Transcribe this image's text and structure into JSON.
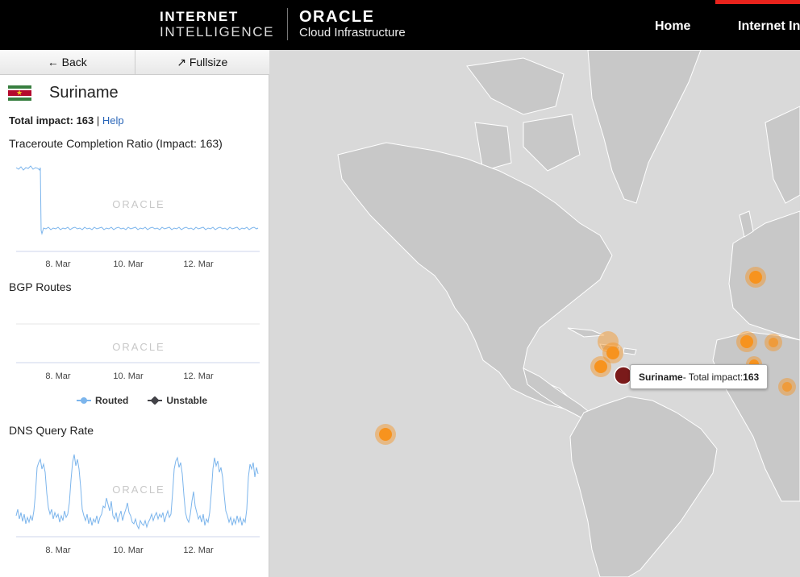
{
  "header": {
    "brand_line1": "INTERNET",
    "brand_line2": "INTELLIGENCE",
    "oracle_line1": "ORACLE",
    "oracle_line2": "Cloud Infrastructure",
    "nav": [
      {
        "label": "Home"
      },
      {
        "label": "Internet In"
      }
    ],
    "accent_color": "#e8231c"
  },
  "sidebar": {
    "back_label": "← Back",
    "fullsize_label": "↗ Fullsize",
    "country": "Suriname",
    "impact_label": "Total impact:",
    "impact_value": "163",
    "separator": "|",
    "help_label": "Help",
    "watermark": "ORACLE",
    "charts": {
      "traceroute": {
        "title": "Traceroute Completion Ratio (Impact: 163)",
        "ticks": [
          "8. Mar",
          "10. Mar",
          "12. Mar"
        ]
      },
      "bgp": {
        "title": "BGP Routes",
        "ticks": [
          "8. Mar",
          "10. Mar",
          "12. Mar"
        ],
        "legend": [
          {
            "label": "Routed",
            "color": "#7cb5ec"
          },
          {
            "label": "Unstable",
            "color": "#434348"
          }
        ]
      },
      "dns": {
        "title": "DNS Query Rate",
        "ticks": [
          "8. Mar",
          "10. Mar",
          "12. Mar"
        ]
      }
    }
  },
  "map": {
    "tooltip": {
      "country": "Suriname",
      "text": " - Total impact: ",
      "value": "163"
    },
    "land_color": "#c8c8c8",
    "ocean_color": "#d9d9d9",
    "marker_color": "#f7931e",
    "selected_marker_color": "#7a1a1a"
  }
}
